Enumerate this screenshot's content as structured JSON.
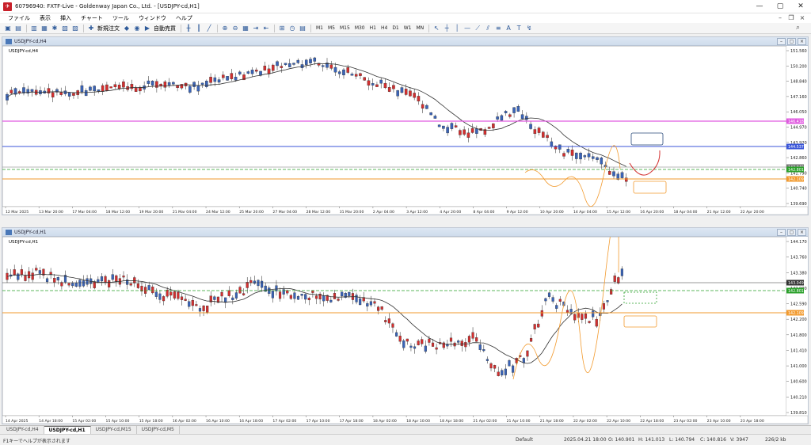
{
  "window": {
    "title": "60796940: FXTF-Live - Goldenway Japan Co., Ltd. - [USDJPY-cd,H1]",
    "controls": [
      "—",
      "▢",
      "✕"
    ]
  },
  "menu": {
    "items": [
      "ファイル",
      "表示",
      "挿入",
      "チャート",
      "ツール",
      "ウィンドウ",
      "ヘルプ"
    ]
  },
  "toolbar": {
    "new_order_label": "新規注文",
    "auto_trading_label": "自動売買",
    "timeframes": [
      "M1",
      "M5",
      "M15",
      "M30",
      "H1",
      "H4",
      "D1",
      "W1",
      "MN"
    ]
  },
  "colors": {
    "bull": "#d32f2f",
    "bear": "#3a64b8",
    "ma": "#333333",
    "magenta_line": "#e05ae0",
    "blue_line": "#3b56d8",
    "green_line": "#2aa02a",
    "orange_line": "#f29a2e",
    "pink_line": "#d6a0d6"
  },
  "chart_h4": {
    "title": "USDJPY-cd,H4",
    "label": "USDJPY-cd,H4",
    "y_labels": [
      "151.560",
      "150.200",
      "148.840",
      "147.160",
      "146.050",
      "144.970",
      "143.920",
      "142.860",
      "141.790",
      "140.740",
      "139.690"
    ],
    "price_tags": [
      {
        "text": "146.418",
        "color": "#e05ae0"
      },
      {
        "text": "144.537",
        "color": "#3b56d8"
      },
      {
        "text": "143.049",
        "color": "#777777"
      },
      {
        "text": "142.801",
        "color": "#2aa02a"
      },
      {
        "text": "142.109",
        "color": "#f29a2e"
      }
    ],
    "x_labels": [
      "12 Mar 2025",
      "13 Mar 20:00",
      "17 Mar 04:00",
      "18 Mar 12:00",
      "19 Mar 20:00",
      "21 Mar 04:00",
      "24 Mar 12:00",
      "25 Mar 20:00",
      "27 Mar 04:00",
      "28 Mar 12:00",
      "31 Mar 20:00",
      "2 Apr 04:00",
      "3 Apr 12:00",
      "4 Apr 20:00",
      "8 Apr 04:00",
      "9 Apr 12:00",
      "10 Apr 20:00",
      "14 Apr 04:00",
      "15 Apr 12:00",
      "16 Apr 20:00",
      "18 Apr 04:00",
      "21 Apr 12:00",
      "22 Apr 20:00"
    ]
  },
  "chart_h1": {
    "title": "USDJPY-cd,H1",
    "label": "USDJPY-cd,H1",
    "y_labels": [
      "144.170",
      "143.760",
      "143.380",
      "142.990",
      "142.590",
      "142.200",
      "141.800",
      "141.410",
      "141.000",
      "140.600",
      "140.210",
      "139.810"
    ],
    "price_tags": [
      {
        "text": "143.049",
        "color": "#333333"
      },
      {
        "text": "142.801",
        "color": "#2aa02a"
      },
      {
        "text": "142.109",
        "color": "#f29a2e"
      }
    ],
    "x_labels": [
      "14 Apr 2025",
      "14 Apr 18:00",
      "15 Apr 02:00",
      "15 Apr 10:00",
      "15 Apr 18:00",
      "16 Apr 02:00",
      "16 Apr 10:00",
      "16 Apr 18:00",
      "17 Apr 02:00",
      "17 Apr 10:00",
      "17 Apr 18:00",
      "18 Apr 02:00",
      "18 Apr 10:00",
      "18 Apr 18:00",
      "21 Apr 02:00",
      "21 Apr 10:00",
      "21 Apr 18:00",
      "22 Apr 02:00",
      "22 Apr 10:00",
      "22 Apr 18:00",
      "23 Apr 02:00",
      "23 Apr 10:00",
      "23 Apr 18:00"
    ]
  },
  "tabs": [
    {
      "label": "USDJPY-cd,H4",
      "active": false
    },
    {
      "label": "USDJPY-cd,H1",
      "active": true
    },
    {
      "label": "USDJPY-cd,M15",
      "active": false
    },
    {
      "label": "USDJPY-cd,M5",
      "active": false
    }
  ],
  "status": {
    "help": "F1キーでヘルプが表示されます",
    "profile": "Default",
    "datetime": "2025.04.21 18:00",
    "open": "O: 140.901",
    "high": "H: 141.013",
    "low": "L: 140.794",
    "close": "C: 140.816",
    "volume": "V: 3947",
    "traffic": "226/2 kb"
  }
}
